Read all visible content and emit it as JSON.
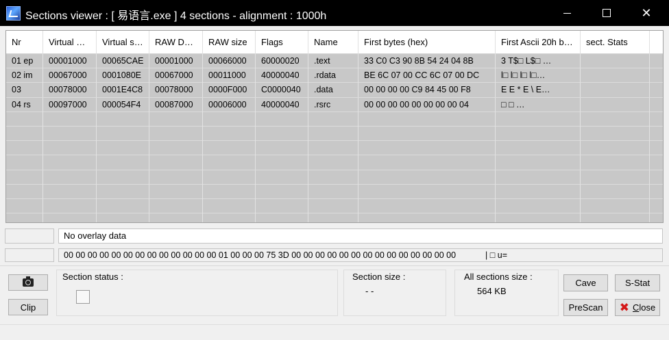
{
  "window": {
    "title": "Sections viewer :  [ 易语言.exe ] 4 sections - alignment : 1000h",
    "minimize_glyph": "",
    "maximize_glyph": "",
    "close_glyph": "✕"
  },
  "grid": {
    "columns": [
      "Nr",
      "Virtual …",
      "Virtual s…",
      "RAW D…",
      "RAW size",
      "Flags",
      "Name",
      "First bytes (hex)",
      "First Ascii 20h b…",
      "sect. Stats"
    ],
    "rows": [
      {
        "nr": "01 ep",
        "virtual_offset": "00001000",
        "virtual_size": "00065CAE",
        "raw_data": "00001000",
        "raw_size": "00066000",
        "flags": "60000020",
        "name": ".text",
        "first_bytes": "33 C0 C3 90 8B 54 24 04 8B",
        "first_ascii": "3   T$□ L$□  …",
        "stats": ""
      },
      {
        "nr": "02 im",
        "virtual_offset": "00067000",
        "virtual_size": "0001080E",
        "raw_data": "00067000",
        "raw_size": "00011000",
        "flags": "40000040",
        "name": ".rdata",
        "first_bytes": "BE 6C 07 00 CC 6C 07 00 DC",
        "first_ascii": "l□  l□  l□  l□…",
        "stats": ""
      },
      {
        "nr": "03",
        "virtual_offset": "00078000",
        "virtual_size": "0001E4C8",
        "raw_data": "00078000",
        "raw_size": "0000F000",
        "flags": "C0000040",
        "name": ".data",
        "first_bytes": "00 00 00 00 C9 84 45 00 F8",
        "first_ascii": "     E   E * E \\ E…",
        "stats": ""
      },
      {
        "nr": "04 rs",
        "virtual_offset": "00097000",
        "virtual_size": "000054F4",
        "raw_data": "00087000",
        "raw_size": "00006000",
        "flags": "40000040",
        "name": ".rsrc",
        "first_bytes": "00 00 00 00 00 00 00 00 04",
        "first_ascii": "         □    □       …",
        "stats": ""
      }
    ]
  },
  "overlay": {
    "text": "No overlay data"
  },
  "hexline": {
    "bytes": "00 00 00 00 00 00 00 00 00 00 00 00 00 01 00 00 00 75 3D 00 00 00 00 00 00 00 00 00 00 00 00 00 00",
    "ascii": "|                □   u="
  },
  "buttons": {
    "clip": "Clip",
    "cave": "Cave",
    "sstat": "S-Stat",
    "prescan": "PreScan",
    "close": "Close"
  },
  "section_status": {
    "label": "Section status :"
  },
  "section_size": {
    "label": "Section size :",
    "value": "- -"
  },
  "all_sections_size": {
    "label": "All sections size :",
    "value": "564 KB"
  },
  "colors": {
    "titlebar_bg": "#000000",
    "grid_bg": "#c8c8c8",
    "close_icon": "#d41717"
  }
}
